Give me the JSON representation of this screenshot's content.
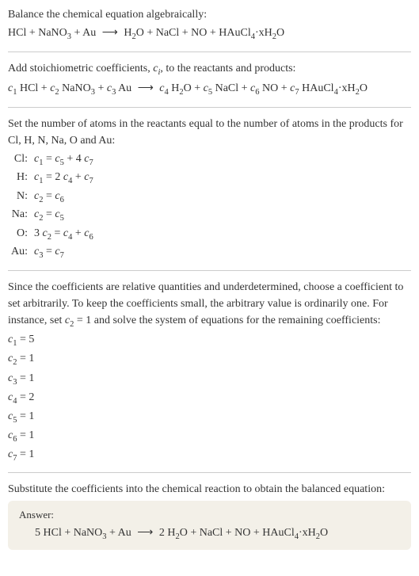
{
  "section1": {
    "title": "Balance the chemical equation algebraically:",
    "equation_parts": {
      "lhs1": "HCl + NaNO",
      "lhs2": " + Au ",
      "rhs1": " H",
      "rhs2": "O + NaCl + NO + HAuCl",
      "rhs3": "·xH",
      "rhs4": "O"
    }
  },
  "section2": {
    "title_a": "Add stoichiometric coefficients, ",
    "title_b": ", to the reactants and products:",
    "ci": "c",
    "ci_sub": "i",
    "eq": {
      "c1": "c",
      "c1s": "1",
      "t1": " HCl + ",
      "c2": "c",
      "c2s": "2",
      "t2": " NaNO",
      "t3": " + ",
      "c3": "c",
      "c3s": "3",
      "t4": " Au ",
      "c4": "c",
      "c4s": "4",
      "t5": " H",
      "t6": "O + ",
      "c5": "c",
      "c5s": "5",
      "t7": " NaCl + ",
      "c6": "c",
      "c6s": "6",
      "t8": " NO + ",
      "c7": "c",
      "c7s": "7",
      "t9": " HAuCl",
      "t10": "·xH",
      "t11": "O"
    }
  },
  "section3": {
    "title": "Set the number of atoms in the reactants equal to the number of atoms in the products for Cl, H, N, Na, O and Au:",
    "rows": [
      {
        "label": "Cl:",
        "c1": "c",
        "s1": "1",
        "mid": " = ",
        "c2": "c",
        "s2": "5",
        "plus": " + 4 ",
        "c3": "c",
        "s3": "7"
      },
      {
        "label": "H:",
        "c1": "c",
        "s1": "1",
        "mid": " = 2 ",
        "c2": "c",
        "s2": "4",
        "plus": " + ",
        "c3": "c",
        "s3": "7"
      },
      {
        "label": "N:",
        "c1": "c",
        "s1": "2",
        "mid": " = ",
        "c2": "c",
        "s2": "6"
      },
      {
        "label": "Na:",
        "c1": "c",
        "s1": "2",
        "mid": " = ",
        "c2": "c",
        "s2": "5"
      },
      {
        "label": "O:",
        "pre": "3 ",
        "c1": "c",
        "s1": "2",
        "mid": " = ",
        "c2": "c",
        "s2": "4",
        "plus": " + ",
        "c3": "c",
        "s3": "6"
      },
      {
        "label": "Au:",
        "c1": "c",
        "s1": "3",
        "mid": " = ",
        "c2": "c",
        "s2": "7"
      }
    ]
  },
  "section4": {
    "title_a": "Since the coefficients are relative quantities and underdetermined, choose a coefficient to set arbitrarily. To keep the coefficients small, the arbitrary value is ordinarily one. For instance, set ",
    "setc": "c",
    "setcs": "2",
    "setval": " = 1",
    "title_b": " and solve the system of equations for the remaining coefficients:",
    "coeffs": [
      {
        "c": "c",
        "s": "1",
        "v": " = 5"
      },
      {
        "c": "c",
        "s": "2",
        "v": " = 1"
      },
      {
        "c": "c",
        "s": "3",
        "v": " = 1"
      },
      {
        "c": "c",
        "s": "4",
        "v": " = 2"
      },
      {
        "c": "c",
        "s": "5",
        "v": " = 1"
      },
      {
        "c": "c",
        "s": "6",
        "v": " = 1"
      },
      {
        "c": "c",
        "s": "7",
        "v": " = 1"
      }
    ]
  },
  "section5": {
    "title": "Substitute the coefficients into the chemical reaction to obtain the balanced equation:"
  },
  "answer": {
    "label": "Answer:",
    "eq": {
      "t1": "5 HCl + NaNO",
      "t2": " + Au ",
      "t3": " 2 H",
      "t4": "O + NaCl + NO + HAuCl",
      "t5": "·xH",
      "t6": "O"
    }
  },
  "subs": {
    "three": "3",
    "two": "2",
    "four": "4"
  },
  "arrow": "⟶"
}
